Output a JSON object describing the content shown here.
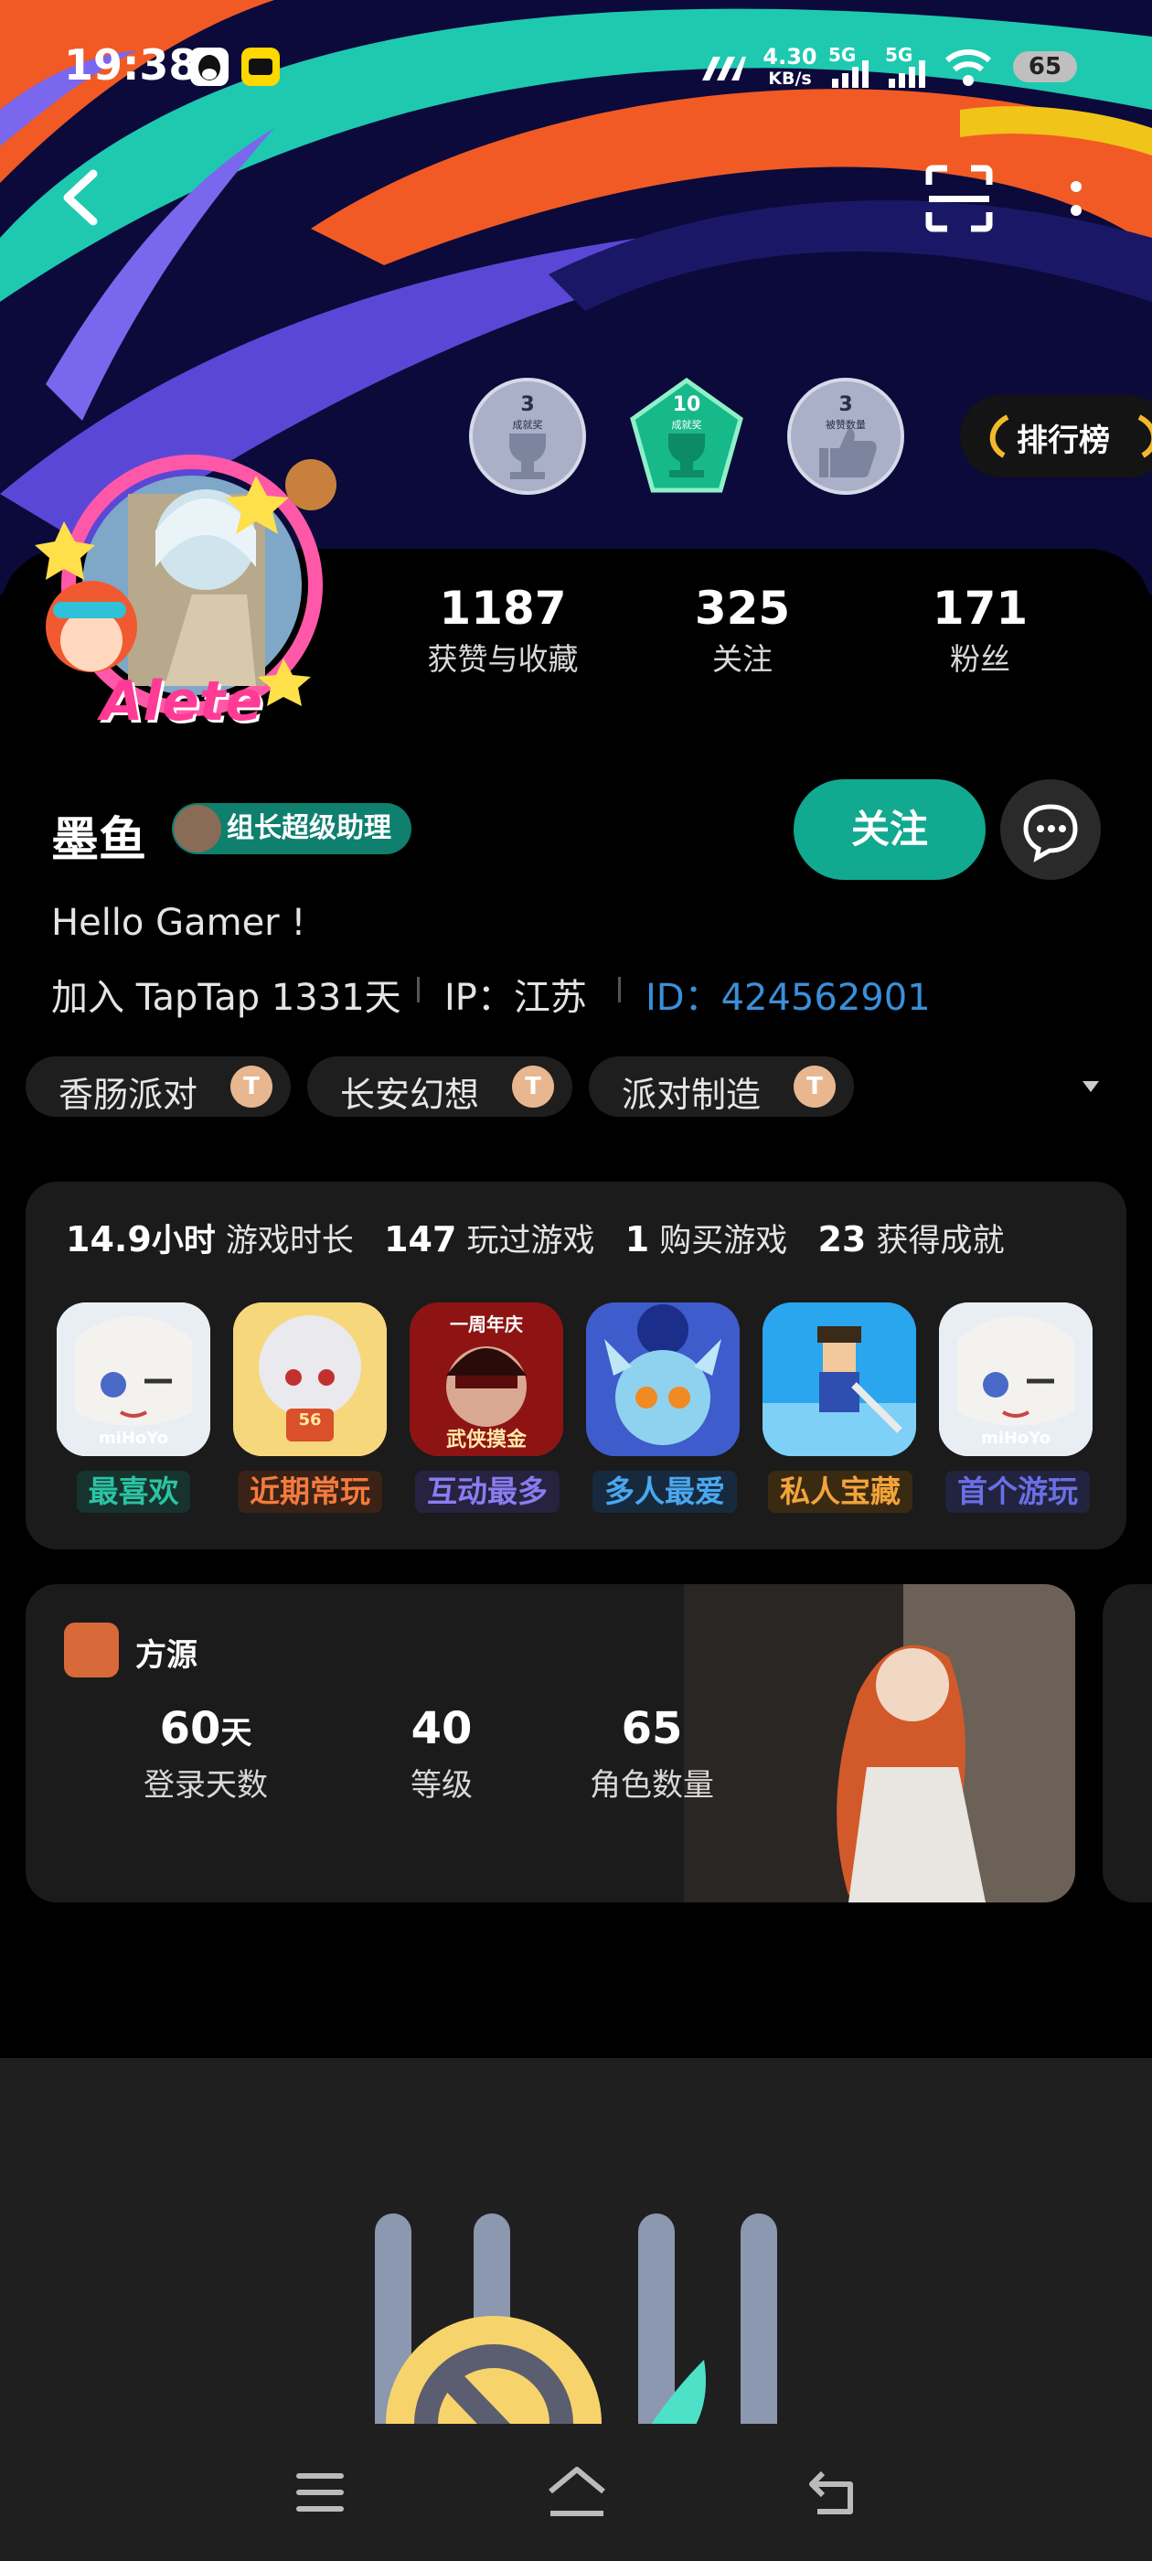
{
  "status_bar": {
    "time": "19:38",
    "speed_top": "4.30",
    "speed_unit": "KB/s",
    "net1": "5G",
    "net2": "5G",
    "battery": "65"
  },
  "profile": {
    "stats": [
      {
        "value": "1187",
        "label": "获赞与收藏"
      },
      {
        "value": "325",
        "label": "关注"
      },
      {
        "value": "171",
        "label": "粉丝"
      }
    ],
    "achievements": [
      {
        "count": "3",
        "label": "成就奖"
      },
      {
        "count": "10",
        "label": "成就奖"
      },
      {
        "count": "3",
        "label": "被赞数量"
      }
    ],
    "ranking_label": "排行榜",
    "avatar_frame_text": "Alete",
    "name": "墨鱼",
    "badge": "组长超级助理",
    "follow_label": "关注",
    "bio": "Hello Gamer !",
    "joined": "加入 TapTap 1331天",
    "ip": "IP：江苏",
    "id": "ID：424562901",
    "tags": [
      {
        "label": "香肠派对",
        "coin": "T"
      },
      {
        "label": "长安幻想",
        "coin": "T"
      },
      {
        "label": "派对制造",
        "coin": "T"
      }
    ]
  },
  "play_stats": {
    "hours_value": "14.9",
    "hours_unit": "小时",
    "hours_label": "游戏时长",
    "played_value": "147",
    "played_label": "玩过游戏",
    "bought_value": "1",
    "bought_label": "购买游戏",
    "achievements_value": "23",
    "achievements_label": "获得成就"
  },
  "games": [
    {
      "label": "最喜欢",
      "color": "#2bc3a3",
      "icon_text": "miHoYo"
    },
    {
      "label": "近期常玩",
      "color": "#f57a3d",
      "icon_text": "56"
    },
    {
      "label": "互动最多",
      "color": "#8b7cf0",
      "icon_text": "武侠摸金"
    },
    {
      "label": "多人最爱",
      "color": "#4aa8f0",
      "icon_text": ""
    },
    {
      "label": "私人宝藏",
      "color": "#f2a43a",
      "icon_text": ""
    },
    {
      "label": "首个游玩",
      "color": "#6a6fe6",
      "icon_text": "miHoYo"
    }
  ],
  "game_card_top_text": "一周年庆",
  "game_card": {
    "title": "方源",
    "metrics": [
      {
        "value": "60",
        "unit": "天",
        "label": "登录天数"
      },
      {
        "value": "40",
        "unit": "",
        "label": "等级"
      },
      {
        "value": "65",
        "unit": "",
        "label": "角色数量"
      }
    ]
  },
  "colors": {
    "accent": "#11a98f",
    "link": "#3b8fd9",
    "banner_bg": "#0b0a3a",
    "banner_teal": "#1ec9b0",
    "banner_orange": "#f15a24",
    "banner_purple": "#5b47d6"
  }
}
